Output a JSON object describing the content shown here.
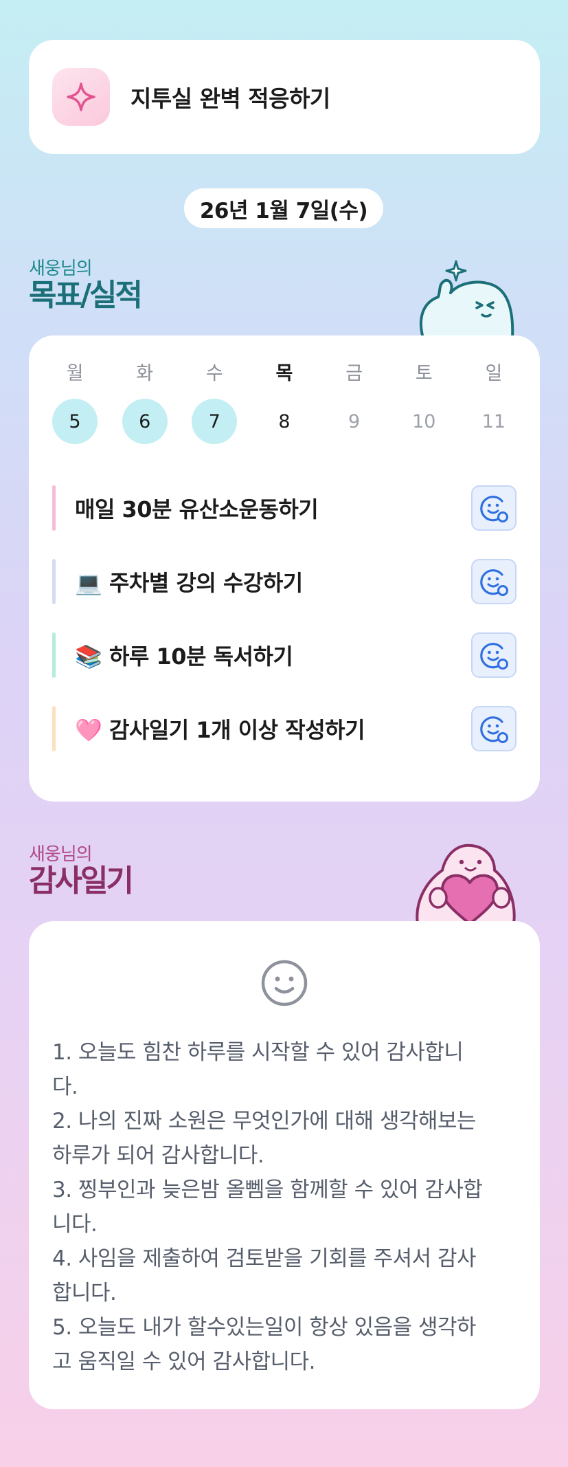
{
  "header": {
    "title": "지투실 완벽 적응하기",
    "icon": "sparkle-icon"
  },
  "date": "26년 1월 7일(수)",
  "goals_section": {
    "subtitle": "새웅님의",
    "title": "목표/실적"
  },
  "week": {
    "days": [
      {
        "label": "월",
        "num": "5",
        "state": "done"
      },
      {
        "label": "화",
        "num": "6",
        "state": "done"
      },
      {
        "label": "수",
        "num": "7",
        "state": "done"
      },
      {
        "label": "목",
        "num": "8",
        "state": "today"
      },
      {
        "label": "금",
        "num": "9",
        "state": "future"
      },
      {
        "label": "토",
        "num": "10",
        "state": "future"
      },
      {
        "label": "일",
        "num": "11",
        "state": "future"
      }
    ]
  },
  "goals": [
    {
      "text": "매일 30분 유산소운동하기",
      "color": "#f7bcd9"
    },
    {
      "text": "💻 주차별 강의 수강하기",
      "color": "#d5dcf1"
    },
    {
      "text": "📚 하루 10분 독서하기",
      "color": "#b7ecd9"
    },
    {
      "text": "🩷 감사일기 1개 이상 작성하기",
      "color": "#fbe1c2"
    }
  ],
  "thanks_section": {
    "subtitle": "새웅님의",
    "title": "감사일기"
  },
  "diary": {
    "lines": [
      "1. 오늘도 힘찬 하루를 시작할 수 있어 감사합니",
      "다.",
      "2. 나의 진짜 소원은 무엇인가에 대해 생각해보는",
      "하루가 되어 감사합니다.",
      "3. 찡부인과 늦은밤 올뻼을 함께할 수 있어 감사합",
      "니다.",
      "4. 사임을 제출하여 검토받을 기회를 주셔서 감사",
      "합니다.",
      "5. 오늘도 내가 할수있는일이 항상 있음을 생각하",
      "고 움직일 수 있어 감사합니다."
    ]
  },
  "colors": {
    "accent_teal": "#1b6f78",
    "accent_plum": "#8a2f66",
    "done_circle": "#c3eef3",
    "action_blue": "#2f6fe0"
  }
}
